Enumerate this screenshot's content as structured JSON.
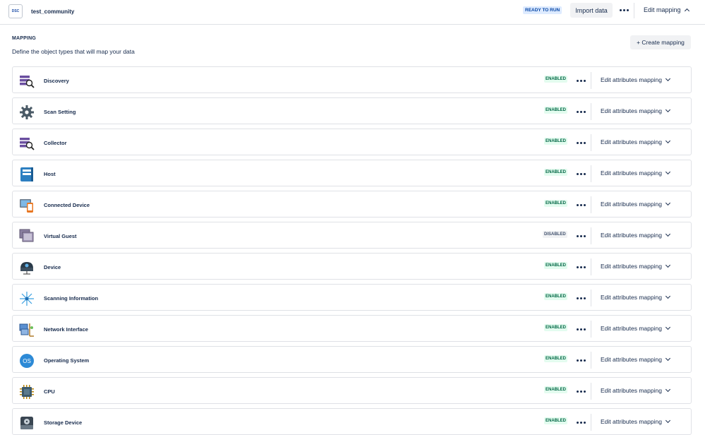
{
  "header": {
    "icon_text": "DSC",
    "title": "test_community",
    "status": "READY TO RUN",
    "import_label": "Import data",
    "edit_mapping_label": "Edit mapping"
  },
  "mapping": {
    "title": "MAPPING",
    "description": "Define the object types that will map your data",
    "create_label": "+ Create mapping",
    "edit_attr_label": "Edit attributes mapping",
    "rows": [
      {
        "label": "Discovery",
        "status": "ENABLED",
        "icon": "discovery-icon"
      },
      {
        "label": "Scan Setting",
        "status": "ENABLED",
        "icon": "gear-icon"
      },
      {
        "label": "Collector",
        "status": "ENABLED",
        "icon": "collector-icon"
      },
      {
        "label": "Host",
        "status": "ENABLED",
        "icon": "host-icon"
      },
      {
        "label": "Connected Device",
        "status": "ENABLED",
        "icon": "connected-device-icon"
      },
      {
        "label": "Virtual Guest",
        "status": "DISABLED",
        "icon": "virtual-guest-icon"
      },
      {
        "label": "Device",
        "status": "ENABLED",
        "icon": "device-icon"
      },
      {
        "label": "Scanning Information",
        "status": "ENABLED",
        "icon": "scanning-icon"
      },
      {
        "label": "Network Interface",
        "status": "ENABLED",
        "icon": "network-interface-icon"
      },
      {
        "label": "Operating System",
        "status": "ENABLED",
        "icon": "os-icon"
      },
      {
        "label": "CPU",
        "status": "ENABLED",
        "icon": "cpu-icon"
      },
      {
        "label": "Storage Device",
        "status": "ENABLED",
        "icon": "storage-device-icon"
      }
    ]
  },
  "icon_glyphs": {
    "os_text": "OS"
  }
}
